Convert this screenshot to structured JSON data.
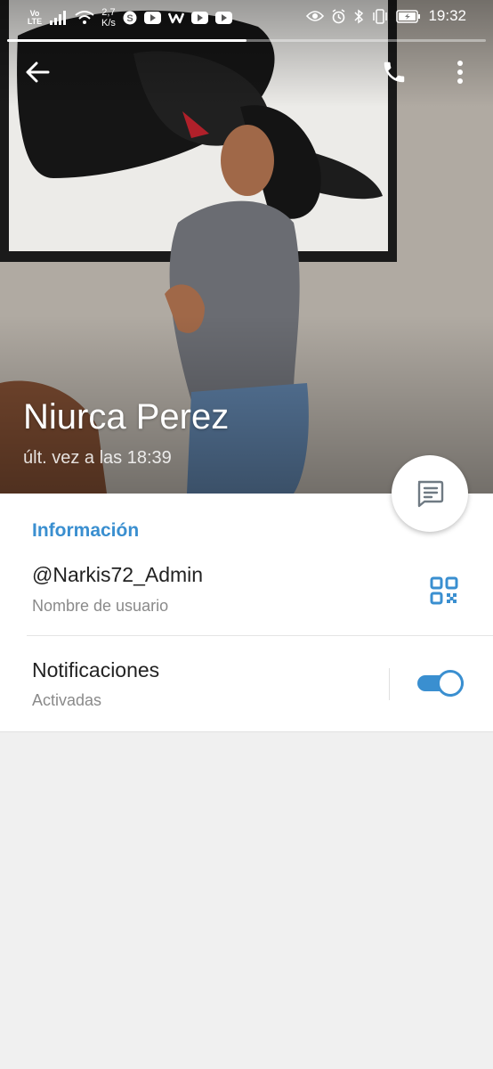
{
  "status_bar": {
    "network": "Vo LTE",
    "speed_value": "2,7",
    "speed_unit": "K/s",
    "time": "19:32",
    "icons": [
      "signal-icon",
      "wifi-icon",
      "skype-icon",
      "youtube-icon",
      "wish-icon",
      "eye-icon",
      "alarm-icon",
      "bluetooth-icon",
      "vibrate-icon",
      "battery-charging-icon"
    ]
  },
  "story_progress": 0.5,
  "header": {
    "back_icon": "arrow-left-icon",
    "call_icon": "phone-icon",
    "more_icon": "more-vertical-icon"
  },
  "profile": {
    "name": "Niurca Perez",
    "last_seen": "últ. vez a las 18:39"
  },
  "fab": {
    "icon": "message-icon"
  },
  "info": {
    "section_title": "Información",
    "username": "@Narkis72_Admin",
    "username_caption": "Nombre de usuario",
    "qr_icon": "qr-code-icon",
    "notifications_title": "Notificaciones",
    "notifications_caption": "Activadas",
    "notifications_enabled": true
  },
  "colors": {
    "accent": "#3a8fd0",
    "background": "#f0f0f0",
    "card": "#ffffff"
  }
}
